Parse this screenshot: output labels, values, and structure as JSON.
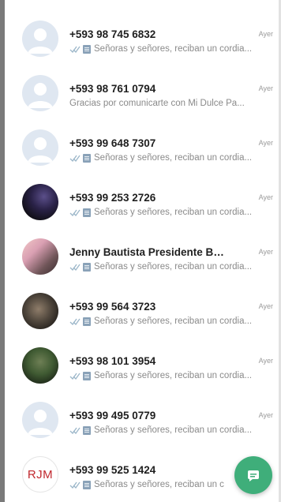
{
  "chats": [
    {
      "name": "+593 98 745 6832",
      "time": "Ayer",
      "preview": "Señoras y señores, reciban un cordia...",
      "avatar": "default",
      "ticks": true,
      "doc": true
    },
    {
      "name": "+593 98 761 0794",
      "time": "Ayer",
      "preview": "Gracias por comunicarte con Mi Dulce Pa...",
      "avatar": "default",
      "ticks": false,
      "doc": false
    },
    {
      "name": "+593 99 648 7307",
      "time": "Ayer",
      "preview": "Señoras y señores, reciban un cordia...",
      "avatar": "default",
      "ticks": true,
      "doc": true
    },
    {
      "name": "+593 99 253 2726",
      "time": "Ayer",
      "preview": "Señoras y señores, reciban un cordia...",
      "avatar": "photo-1",
      "ticks": true,
      "doc": true
    },
    {
      "name": "Jenny Bautista Presidente Barrio...",
      "time": "Ayer",
      "preview": "Señoras y señores, reciban un cordia...",
      "avatar": "photo-2",
      "ticks": true,
      "doc": true
    },
    {
      "name": "+593 99 564 3723",
      "time": "Ayer",
      "preview": "Señoras y señores, reciban un cordia...",
      "avatar": "photo-3",
      "ticks": true,
      "doc": true
    },
    {
      "name": "+593 98 101 3954",
      "time": "Ayer",
      "preview": "Señoras y señores, reciban un cordia...",
      "avatar": "photo-4",
      "ticks": true,
      "doc": true
    },
    {
      "name": "+593 99 495 0779",
      "time": "Ayer",
      "preview": "Señoras y señores, reciban un cordia...",
      "avatar": "default",
      "ticks": true,
      "doc": true
    },
    {
      "name": "+593 99 525 1424",
      "time": "",
      "preview": "Señoras y señores, reciban un c",
      "avatar": "initials",
      "initials": "RJM",
      "ticks": true,
      "doc": true
    }
  ],
  "fab": {
    "icon": "new-chat-icon",
    "color": "#3fae7a"
  },
  "colors": {
    "tick": "#9bb6c9",
    "default_avatar_bg": "#dfe7f1",
    "default_avatar_fg": "#ffffff",
    "initials_text": "#c0272d"
  }
}
